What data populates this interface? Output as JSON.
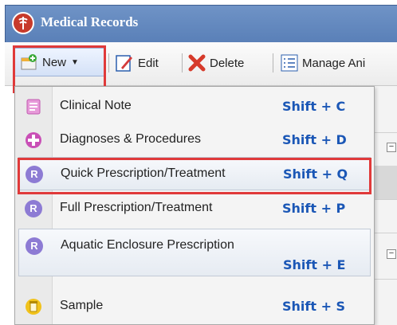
{
  "window": {
    "title": "Medical Records"
  },
  "toolbar": {
    "new_label": "New",
    "edit_label": "Edit",
    "delete_label": "Delete",
    "manage_label": "Manage Ani"
  },
  "menu": {
    "items": [
      {
        "label": "Clinical Note",
        "shortcut": "Shift + C",
        "icon": "clinical-note-icon"
      },
      {
        "label": "Diagnoses & Procedures",
        "shortcut": "Shift + D",
        "icon": "diagnoses-cross-icon"
      },
      {
        "label": "Quick Prescription/Treatment",
        "shortcut": "Shift + Q",
        "icon": "rx-icon"
      },
      {
        "label": "Full Prescription/Treatment",
        "shortcut": "Shift + P",
        "icon": "rx-icon"
      },
      {
        "label": "Aquatic Enclosure Prescription",
        "shortcut": "Shift + E",
        "icon": "rx-icon"
      },
      {
        "label": "Sample",
        "shortcut": "Shift + S",
        "icon": "sample-jar-icon"
      }
    ]
  },
  "colors": {
    "titlebar": "#5a80b8",
    "highlight": "#e03a3a",
    "shortcut": "#1b57b6",
    "rx_badge": "#8d7bd4"
  }
}
